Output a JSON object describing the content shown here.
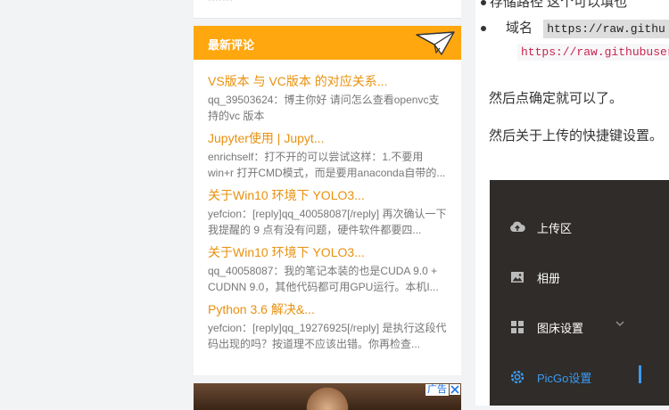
{
  "top_card": {
    "cut_text": "·······"
  },
  "widget": {
    "title": "最新评论",
    "comments": [
      {
        "title": "VS版本 与 VC版本 的对应关系...",
        "body": "qq_39503624：博主你好 请问怎么查看openvc支持的vc 版本"
      },
      {
        "title": "Jupyter使用 | Jupyt...",
        "body": "enrichself：打不开的可以尝试这样：1.不要用win+r 打开CMD模式，而是要用anaconda自带的..."
      },
      {
        "title": "关于Win10 环境下 YOLO3...",
        "body": "yefcion：[reply]qq_40058087[/reply] 再次确认一下我提醒的 9 点有没有问题，硬件软件都要四..."
      },
      {
        "title": "关于Win10 环境下 YOLO3...",
        "body": "qq_40058087：我的笔记本装的也是CUDA 9.0 + CUDNN 9.0，其他代码都可用GPU运行。本机I..."
      },
      {
        "title": "Python 3.6 解决&...",
        "body": "yefcion：[reply]qq_19276925[/reply] 是执行这段代码出现的吗？按道理不应该出错。你再检查..."
      }
    ]
  },
  "ad": {
    "label": "广告"
  },
  "article": {
    "bullet1_text": "存储路径 这个可以填也",
    "bullet2_label": "域名",
    "bullet2_code": "https://raw.githu",
    "bullet2_link": "https://raw.githubuser",
    "para1": "然后点确定就可以了。",
    "para2": "然后关于上传的快捷键设置。"
  },
  "app": {
    "menu": [
      {
        "label": "上传区",
        "icon": "cloud-upload-icon"
      },
      {
        "label": "相册",
        "icon": "picture-icon"
      },
      {
        "label": "图床设置",
        "icon": "grid-icon"
      },
      {
        "label": "PicGo设置",
        "icon": "settings-icon"
      }
    ],
    "accent_color": "#3b9bf2",
    "background_color": "#2f2c29"
  },
  "colors": {
    "widget_header": "#ffa70f",
    "comment_link": "#e8910f"
  }
}
